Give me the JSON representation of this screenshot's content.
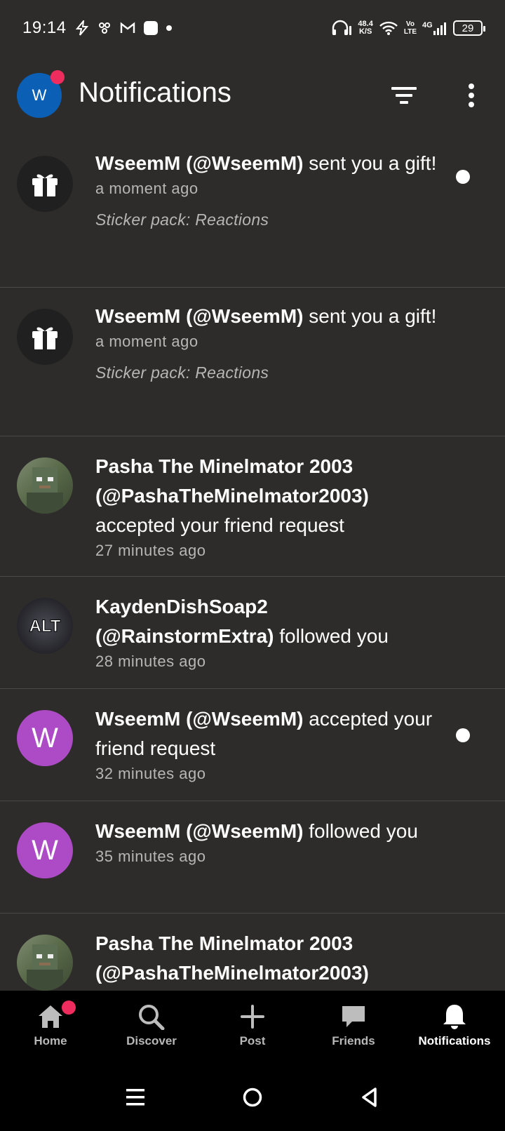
{
  "status_bar": {
    "time": "19:14",
    "net_speed_value": "48.4",
    "net_speed_unit": "K/S",
    "volte_top": "Vo",
    "volte_bottom": "LTE",
    "network": "4G",
    "battery": "29"
  },
  "header": {
    "avatar_letter": "W",
    "title": "Notifications"
  },
  "notifications": [
    {
      "icon": "gift-icon",
      "bold": "WseemM (@WseemM)",
      "text": " sent you a gift!",
      "time": "a moment ago",
      "sub": "Sticker pack: Reactions",
      "unread": true
    },
    {
      "icon": "gift-icon",
      "bold": "WseemM (@WseemM)",
      "text": " sent you a gift!",
      "time": "a moment ago",
      "sub": "Sticker pack: Reactions",
      "unread": false
    },
    {
      "icon": "avatar-minecraft",
      "bold": "Pasha The Minelmator 2003 (@PashaTheMinelmator2003)",
      "text": " accepted your friend request",
      "time": "27 minutes ago",
      "unread": false
    },
    {
      "icon": "avatar-alt",
      "avatar_text": "ALT",
      "bold": "KaydenDishSoap2 (@RainstormExtra)",
      "text": " followed you",
      "time": "28 minutes ago",
      "unread": false
    },
    {
      "icon": "avatar-letter",
      "avatar_text": "W",
      "bold": "WseemM (@WseemM)",
      "text": " accepted your friend request",
      "time": "32 minutes ago",
      "unread": true
    },
    {
      "icon": "avatar-letter",
      "avatar_text": "W",
      "bold": "WseemM (@WseemM)",
      "text": " followed you",
      "time": "35 minutes ago",
      "unread": false
    },
    {
      "icon": "avatar-minecraft",
      "bold": "Pasha The Minelmator 2003 (@PashaTheMinelmator2003)",
      "text": "",
      "time": "",
      "unread": false
    }
  ],
  "bottom_nav": [
    {
      "label": "Home",
      "icon": "home-icon"
    },
    {
      "label": "Discover",
      "icon": "search-icon"
    },
    {
      "label": "Post",
      "icon": "plus-icon"
    },
    {
      "label": "Friends",
      "icon": "chat-icon"
    },
    {
      "label": "Notifications",
      "icon": "bell-icon",
      "active": true
    }
  ],
  "colors": {
    "background": "#2d2c2a",
    "accent_badge": "#ef2c5e",
    "header_avatar": "#0b5fb5",
    "letter_avatar": "#ad4bc6"
  }
}
